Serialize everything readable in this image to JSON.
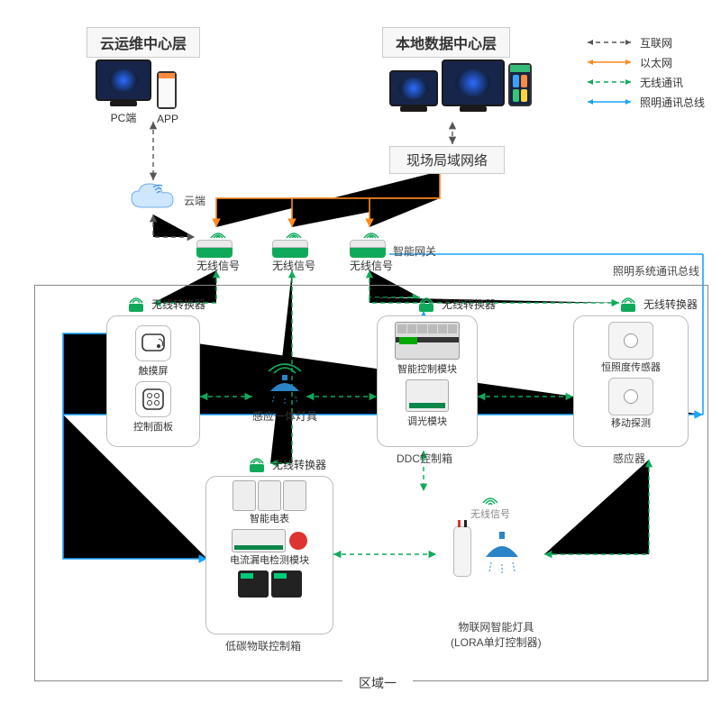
{
  "titles": {
    "cloud_layer": "云运维中心层",
    "local_layer": "本地数据中心层",
    "lan": "现场局域网络"
  },
  "legend": {
    "internet": "互联网",
    "ethernet": "以太网",
    "wireless": "无线通讯",
    "lighting_bus": "照明通讯总线"
  },
  "labels": {
    "pc": "PC端",
    "app": "APP",
    "cloud": "云端",
    "wireless_signal": "无线信号",
    "smart_gateway": "智能网关",
    "lighting_bus_title": "照明系统通讯总线",
    "wireless_converter": "无线转换器",
    "touch_screen": "触摸屏",
    "control_panel": "控制面板",
    "sensor_lamp": "感应一体灯具",
    "smart_control_module": "智能控制模块",
    "dimming_module": "调光模块",
    "ddc_box": "DDC控制箱",
    "illumination_sensor": "恒照度传感器",
    "motion_detector": "移动探测",
    "sensors": "感应器",
    "smart_meter": "智能电表",
    "current_leakage": "电流漏电检测模块",
    "low_carbon_box": "低碳物联控制箱",
    "iot_lamp_1": "物联网智能灯具",
    "iot_lamp_2": "(LORA单灯控制器)",
    "zone": "区域一"
  },
  "colors": {
    "green": "#10a95a",
    "orange": "#ff8a1e",
    "blue": "#1aa3ff",
    "grey": "#555555"
  }
}
